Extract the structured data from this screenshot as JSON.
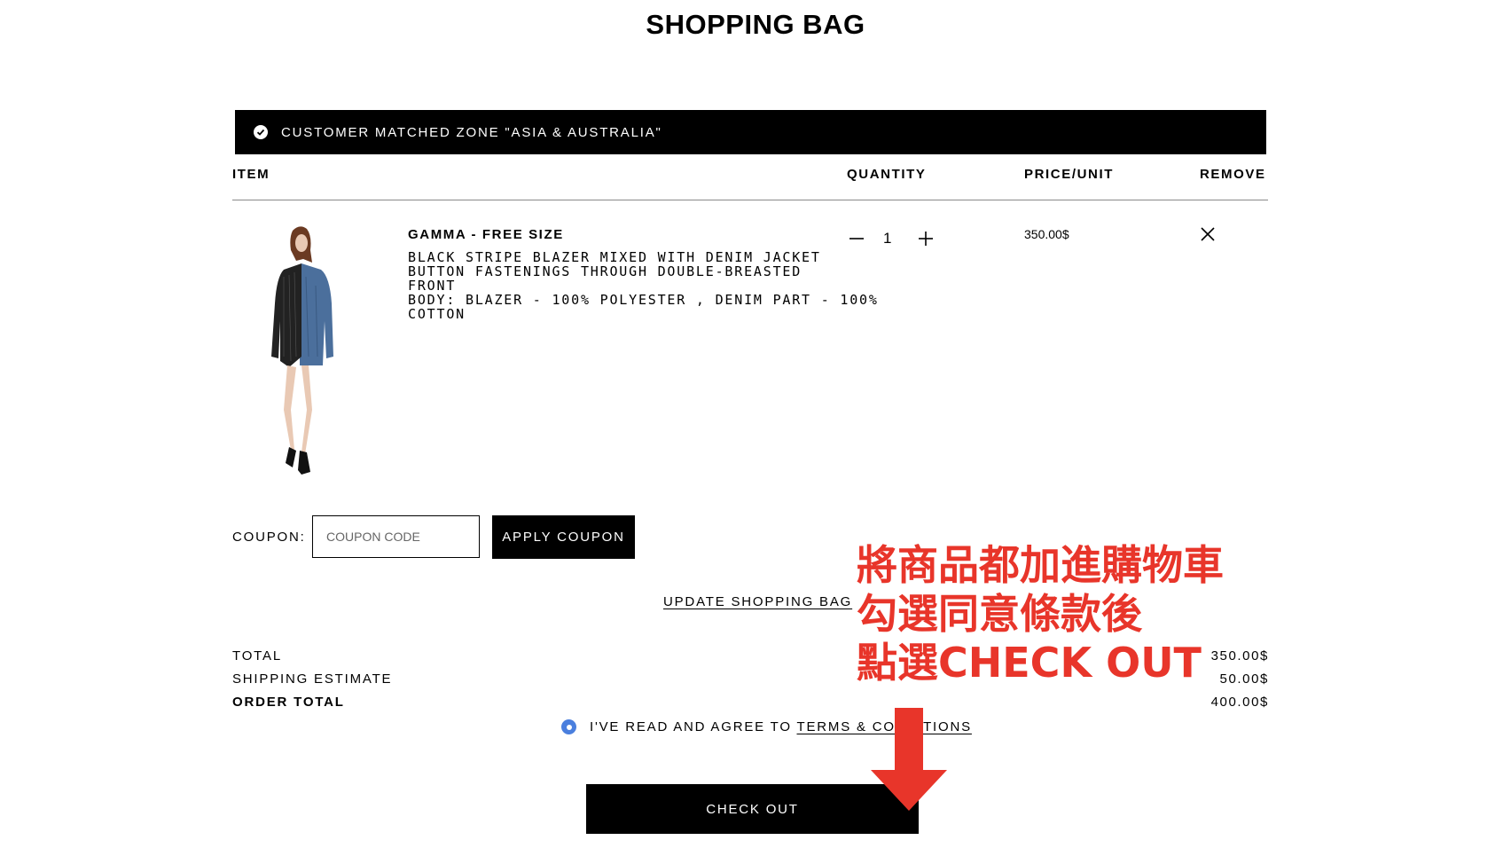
{
  "page": {
    "title": "SHOPPING BAG"
  },
  "zone_banner": {
    "text": "CUSTOMER MATCHED ZONE \"ASIA & AUSTRALIA\""
  },
  "table": {
    "headers": {
      "item": "ITEM",
      "quantity": "QUANTITY",
      "price": "PRICE/UNIT",
      "remove": "REMOVE"
    }
  },
  "item": {
    "name": "GAMMA - FREE SIZE",
    "description_lines": [
      "BLACK STRIPE BLAZER MIXED WITH DENIM JACKET",
      "BUTTON FASTENINGS THROUGH DOUBLE-BREASTED",
      "FRONT",
      "BODY: BLAZER - 100% POLYESTER , DENIM PART - 100%",
      "COTTON"
    ],
    "quantity": "1",
    "price": "350.00$"
  },
  "coupon": {
    "label": "COUPON:",
    "placeholder": "COUPON CODE",
    "apply_label": "APPLY COUPON"
  },
  "update_label": "UPDATE SHOPPING BAG",
  "summary": {
    "total_label": "TOTAL",
    "total_value": "350.00$",
    "shipping_label": "SHIPPING ESTIMATE",
    "shipping_value": "50.00$",
    "order_total_label": "ORDER TOTAL",
    "order_total_value": "400.00$"
  },
  "agree": {
    "text": "I'VE READ AND AGREE TO ",
    "terms_link": "TERMS & CONDITIONS"
  },
  "checkout_label": "CHECK OUT",
  "annotation": {
    "lines": [
      "將商品都加進購物車",
      "勾選同意條款後",
      "點選CHECK OUT"
    ],
    "color": "#e8352a"
  },
  "colors": {
    "accent_blue": "#4a7fde",
    "black": "#000000"
  }
}
